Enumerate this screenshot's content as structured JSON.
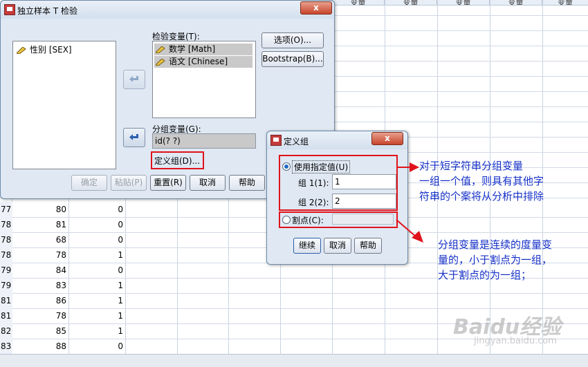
{
  "spreadsheet": {
    "column_header": "变量",
    "rows": [
      {
        "num": "77",
        "a": "80",
        "b": "0"
      },
      {
        "num": "78",
        "a": "81",
        "b": "0"
      },
      {
        "num": "78",
        "a": "68",
        "b": "0"
      },
      {
        "num": "78",
        "a": "78",
        "b": "1"
      },
      {
        "num": "79",
        "a": "84",
        "b": "0"
      },
      {
        "num": "79",
        "a": "83",
        "b": "1"
      },
      {
        "num": "81",
        "a": "86",
        "b": "1"
      },
      {
        "num": "81",
        "a": "78",
        "b": "1"
      },
      {
        "num": "82",
        "a": "85",
        "b": "1"
      },
      {
        "num": "83",
        "a": "88",
        "b": "0"
      }
    ]
  },
  "main_dialog": {
    "title": "独立样本 T 检验",
    "close_label": "x",
    "source_list": [
      "性别 [SEX]"
    ],
    "test_var_label": "检验变量(T):",
    "test_vars": [
      "数学 [Math]",
      "语文 [Chinese]"
    ],
    "group_var_label": "分组变量(G):",
    "group_var_value": "id(? ?)",
    "define_groups_label": "定义组(D)...",
    "options_label": "选项(O)...",
    "bootstrap_label": "Bootstrap(B)...",
    "ok_label": "确定",
    "paste_label": "粘贴(P)",
    "reset_label": "重置(R)",
    "cancel_label": "取消",
    "help_label": "帮助"
  },
  "define_dialog": {
    "title": "定义组",
    "close_label": "x",
    "use_specified_label": "使用指定值(U)",
    "group1_label": "组 1(1):",
    "group1_value": "1",
    "group2_label": "组 2(2):",
    "group2_value": "2",
    "cutpoint_label": "割点(C):",
    "cutpoint_value": "",
    "continue_label": "继续",
    "cancel_label": "取消",
    "help_label": "帮助"
  },
  "annotations": {
    "note1": [
      "对于短字符串分组变量",
      "一组一个值，则具有其他字",
      "符串的个案将从分析中排除"
    ],
    "note2": [
      "分组变量是连续的度量变",
      "量的，小于割点为一组，",
      "大于割点的为一组；"
    ]
  },
  "watermark": {
    "logo": "Baidu经验",
    "url": "jingyan.baidu.com"
  },
  "colors": {
    "annotation_red": "#e0121a",
    "annotation_blue": "#1530c8"
  }
}
